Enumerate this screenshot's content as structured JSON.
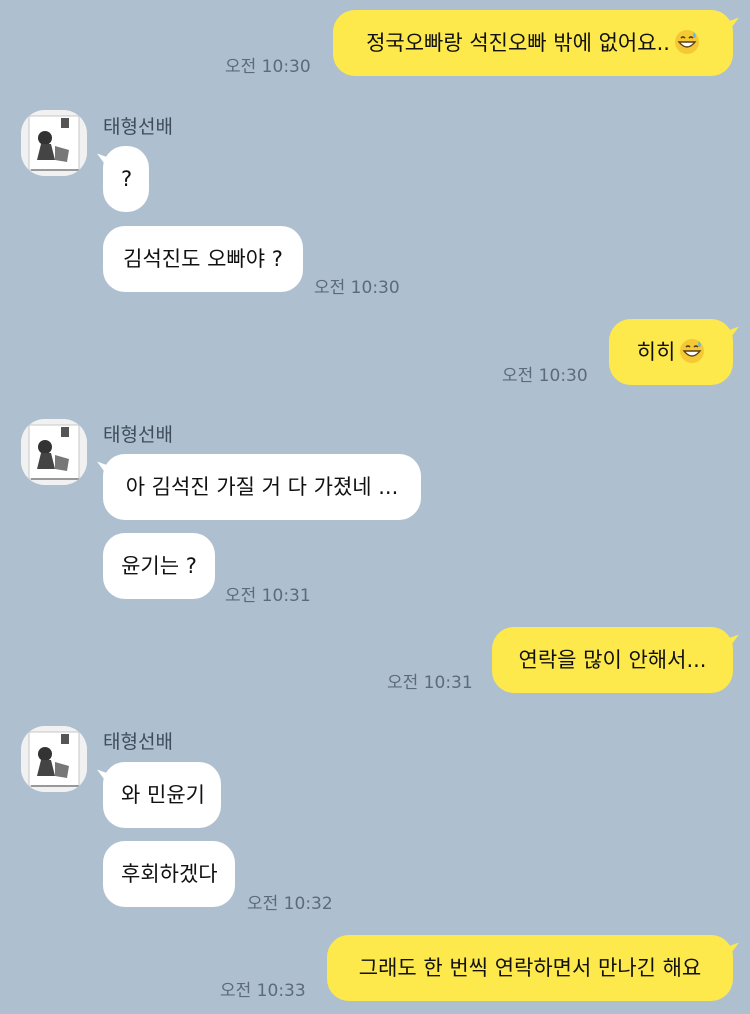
{
  "conversation": {
    "messages": [
      {
        "from": "me",
        "text": "정국오빠랑 석진오빠 밖에 없어요..",
        "emoji": "grinning-sweat-emoji",
        "time": "오전 10:30"
      },
      {
        "from": "them",
        "sender": "태형선배",
        "text": "?"
      },
      {
        "from": "them",
        "text": "김석진도 오빠야 ?",
        "time": "오전 10:30"
      },
      {
        "from": "me",
        "text": "히히",
        "emoji": "grinning-sweat-emoji",
        "time": "오전 10:30"
      },
      {
        "from": "them",
        "sender": "태형선배",
        "text": "아 김석진 가질 거 다 가졌네 ..."
      },
      {
        "from": "them",
        "text": "윤기는 ?",
        "time": "오전 10:31"
      },
      {
        "from": "me",
        "text": "연락을 많이 안해서...",
        "time": "오전 10:31"
      },
      {
        "from": "them",
        "sender": "태형선배",
        "text": "와 민윤기"
      },
      {
        "from": "them",
        "text": "후회하겠다",
        "time": "오전 10:32"
      },
      {
        "from": "me",
        "text": "그래도 한 번씩 연락하면서 만나긴 해요",
        "time": "오전 10:33"
      }
    ]
  },
  "colors": {
    "background": "#aebfcf",
    "my_bubble": "#fde94b",
    "their_bubble": "#ffffff",
    "timestamp": "#5d6b79"
  }
}
